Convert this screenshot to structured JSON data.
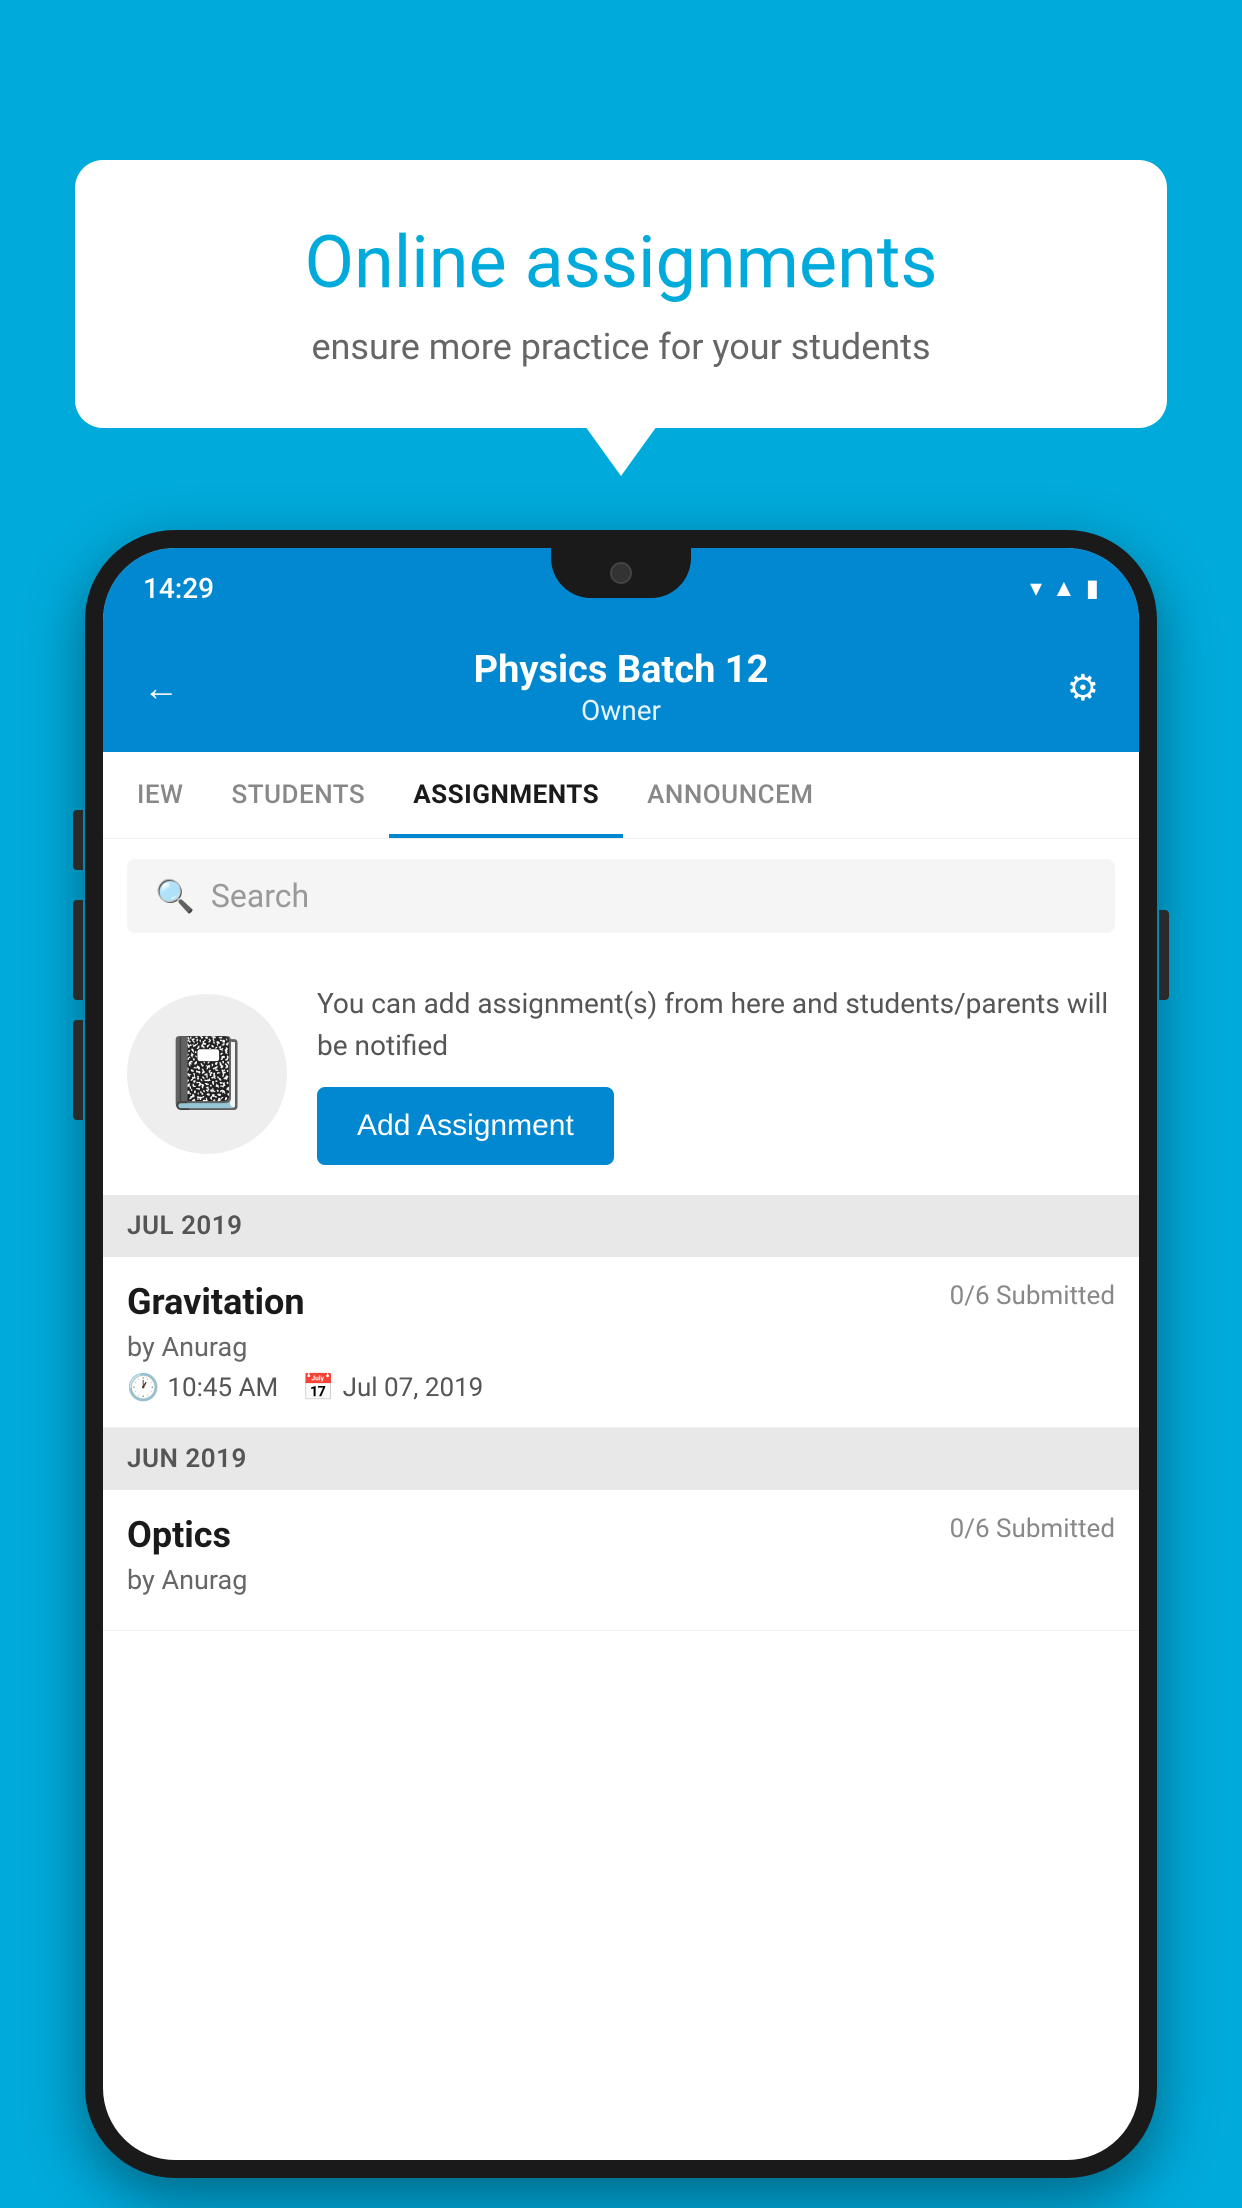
{
  "background_color": "#00AADB",
  "speech_bubble": {
    "title": "Online assignments",
    "subtitle": "ensure more practice for your students"
  },
  "phone": {
    "status_bar": {
      "time": "14:29",
      "icons": [
        "wifi",
        "signal",
        "battery"
      ]
    },
    "header": {
      "title": "Physics Batch 12",
      "subtitle": "Owner",
      "back_label": "←",
      "settings_label": "⚙"
    },
    "tabs": [
      {
        "label": "IEW",
        "active": false
      },
      {
        "label": "STUDENTS",
        "active": false
      },
      {
        "label": "ASSIGNMENTS",
        "active": true
      },
      {
        "label": "ANNOUNCEM",
        "active": false
      }
    ],
    "search": {
      "placeholder": "Search"
    },
    "promo": {
      "text": "You can add assignment(s) from here and students/parents will be notified",
      "button_label": "Add Assignment"
    },
    "sections": [
      {
        "label": "JUL 2019",
        "assignments": [
          {
            "title": "Gravitation",
            "submitted": "0/6 Submitted",
            "author": "by Anurag",
            "time": "10:45 AM",
            "date": "Jul 07, 2019"
          }
        ]
      },
      {
        "label": "JUN 2019",
        "assignments": [
          {
            "title": "Optics",
            "submitted": "0/6 Submitted",
            "author": "by Anurag",
            "time": "",
            "date": ""
          }
        ]
      }
    ]
  }
}
